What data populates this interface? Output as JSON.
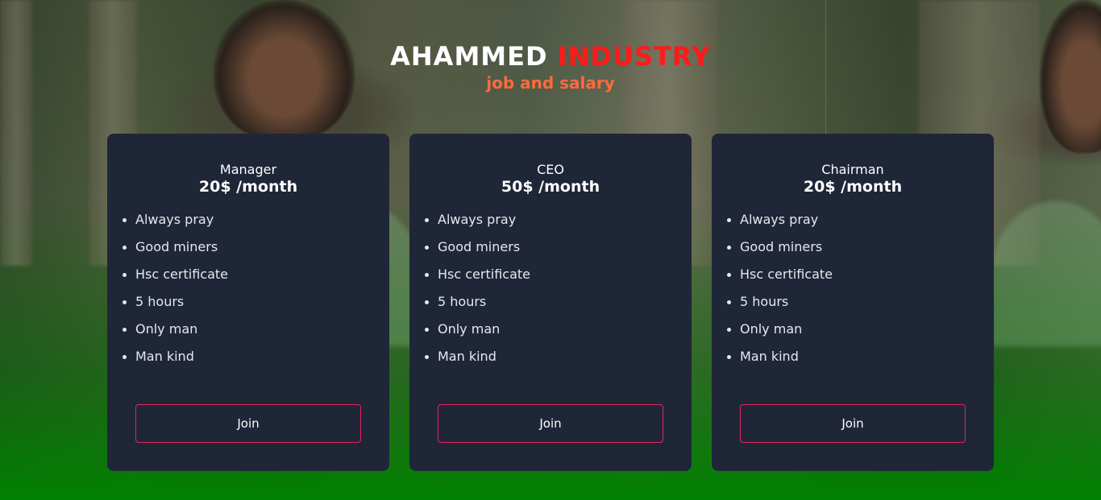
{
  "header": {
    "title_part1": "AHAMMED",
    "title_part2": "INDUSTRY",
    "subtitle": "job and salary"
  },
  "colors": {
    "title_white": "#ffffff",
    "title_red": "#ff1a1a",
    "subtitle_orange": "#ff6a3d",
    "card_bg": "#1f2638",
    "button_border": "#e0285a",
    "bottom_green": "#008000"
  },
  "cards": [
    {
      "name": "Manager",
      "price": "20$ /month",
      "features": [
        "Always pray",
        "Good miners",
        "Hsc certificate",
        "5 hours",
        "Only man",
        "Man kind"
      ],
      "button_label": "Join"
    },
    {
      "name": "CEO",
      "price": "50$ /month",
      "features": [
        "Always pray",
        "Good miners",
        "Hsc certificate",
        "5 hours",
        "Only man",
        "Man kind"
      ],
      "button_label": "Join"
    },
    {
      "name": "Chairman",
      "price": "20$ /month",
      "features": [
        "Always pray",
        "Good miners",
        "Hsc certificate",
        "5 hours",
        "Only man",
        "Man kind"
      ],
      "button_label": "Join"
    }
  ]
}
